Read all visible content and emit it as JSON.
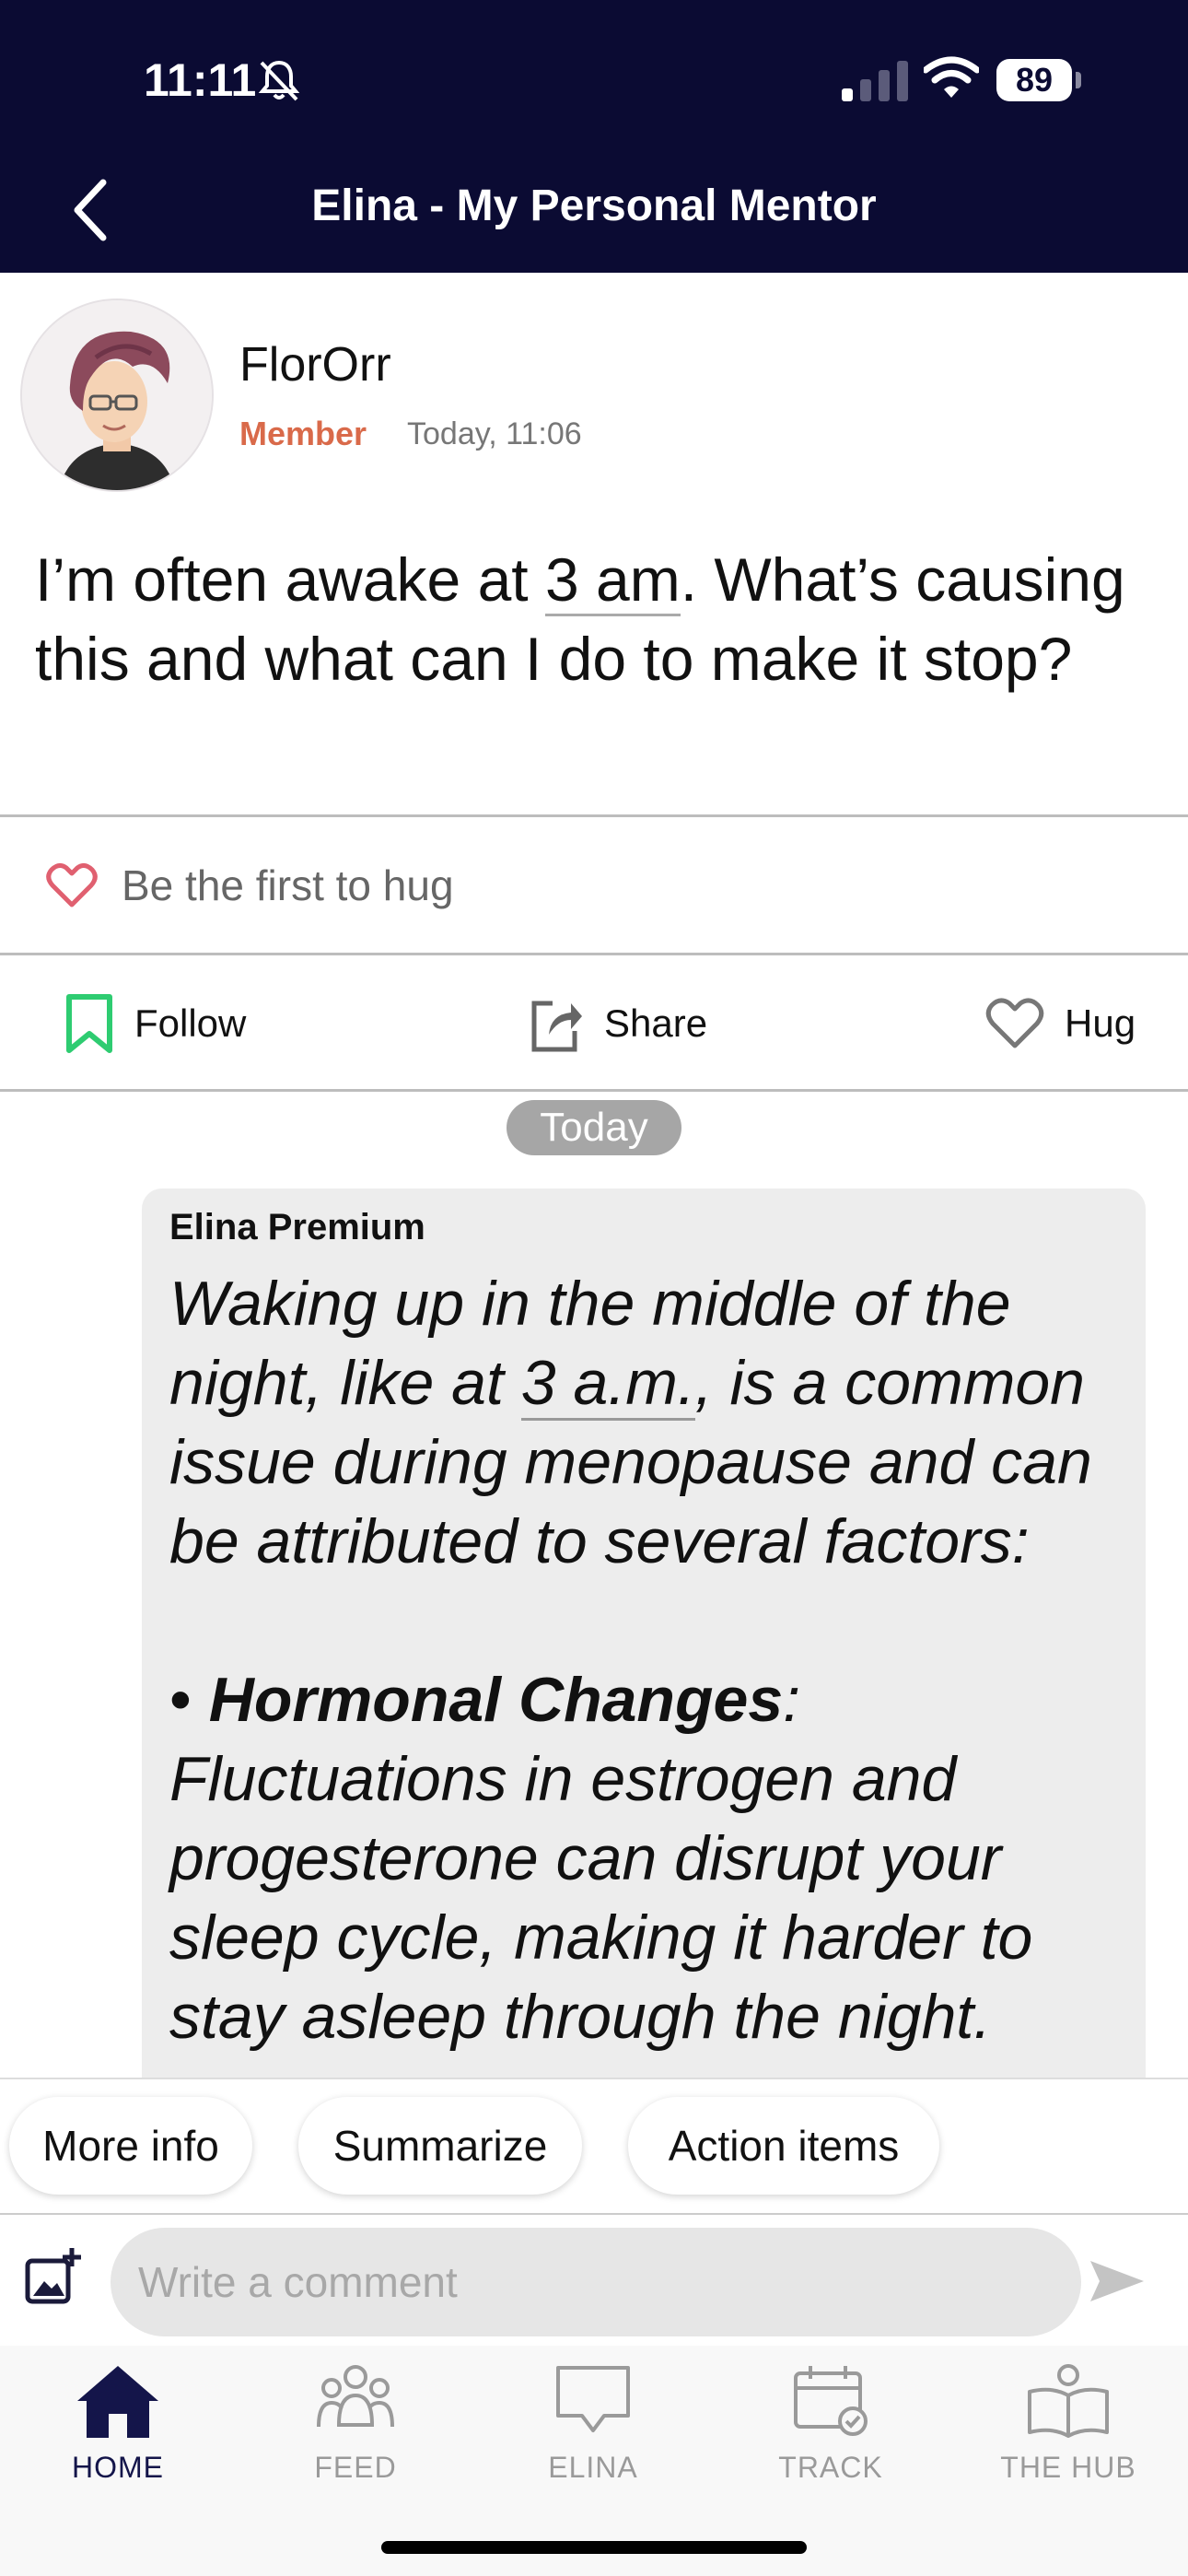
{
  "status_bar": {
    "time": "11:11",
    "battery": "89",
    "icons": [
      "bell-slash-icon",
      "signal-icon",
      "wifi-icon",
      "battery-icon"
    ]
  },
  "header": {
    "back_icon": "chevron-left-icon",
    "title": "Elina - My Personal Mentor"
  },
  "post": {
    "author": "FlorOrr",
    "role": "Member",
    "timestamp": "Today, 11:06",
    "question_before": "I’m often awake at ",
    "question_link": "3 am",
    "question_after": ". What’s causing this and what can I do to make it stop?"
  },
  "hugs": {
    "icon": "heart-icon",
    "text": "Be the first to hug"
  },
  "actions": {
    "follow": "Follow",
    "share": "Share",
    "hug": "Hug"
  },
  "conversation": {
    "date_label": "Today",
    "message": {
      "sender": "Elina Premium",
      "intro_before": "Waking up in the middle of the night, like at ",
      "intro_link": "3 a.m.",
      "intro_after": ", is a common issue during menopause and can be attributed to several factors:",
      "bullet_marker": "•",
      "bullet_title": "Hormonal Changes",
      "bullet_colon": ":",
      "bullet_text": " Fluctuations in estrogen and progesterone can disrupt your sleep cycle, making it harder to stay asleep through the night."
    }
  },
  "suggestions": [
    "More info",
    "Summarize",
    "Action items"
  ],
  "comment": {
    "placeholder": "Write a comment"
  },
  "tabs": [
    {
      "label": "HOME",
      "icon": "home-icon",
      "active": true
    },
    {
      "label": "FEED",
      "icon": "people-icon",
      "active": false
    },
    {
      "label": "ELINA",
      "icon": "chat-bubble-icon",
      "active": false
    },
    {
      "label": "TRACK",
      "icon": "calendar-check-icon",
      "active": false
    },
    {
      "label": "THE HUB",
      "icon": "open-book-icon",
      "active": false
    }
  ],
  "colors": {
    "header_bg": "#0b0b33",
    "member_accent": "#d96a4a",
    "follow_green": "#2ecc71",
    "tab_active": "#14154a",
    "tab_inactive": "#9a9a9a"
  }
}
